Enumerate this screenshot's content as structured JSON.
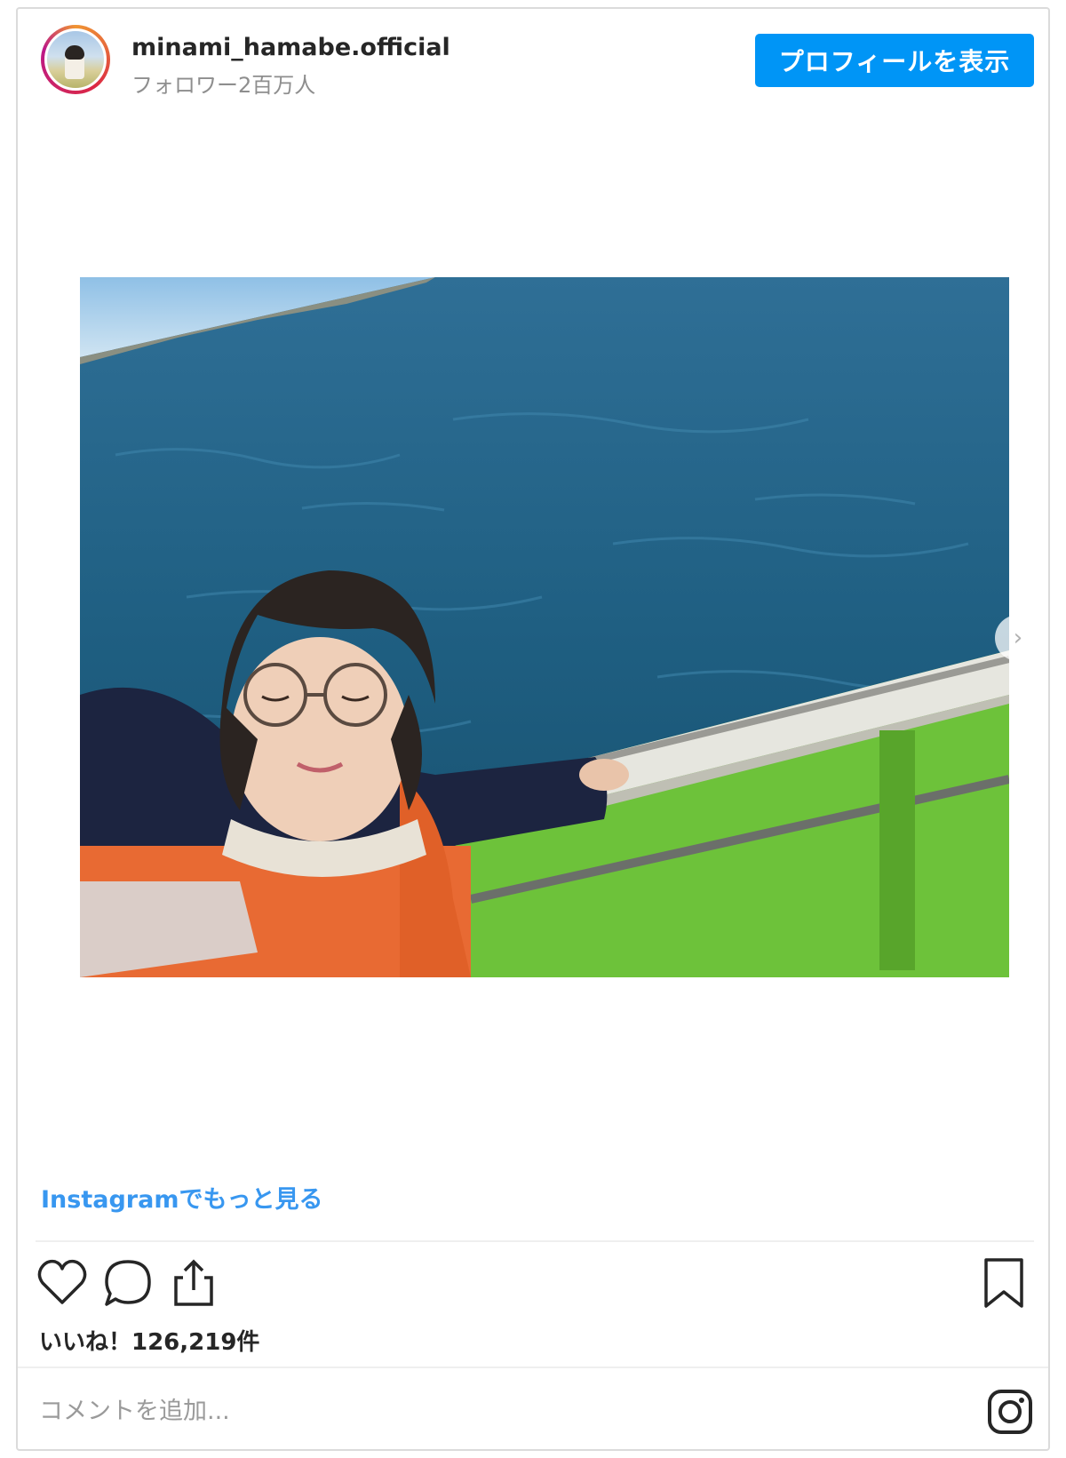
{
  "header": {
    "username": "minami_hamabe.official",
    "followers": "フォロワー2百万人",
    "profile_button": "プロフィールを表示"
  },
  "post": {
    "photo_icon": "photo-of-person-on-boat",
    "next_icon": "chevron-right-icon",
    "more_link": "Instagramでもっと見る",
    "likes": "いいね！126,219件"
  },
  "actions": {
    "icons": [
      "heart-icon",
      "comment-icon",
      "share-icon",
      "bookmark-icon"
    ]
  },
  "comment": {
    "placeholder": "コメントを追加..."
  },
  "colors": {
    "accent": "#0095f6",
    "link": "#3897f0"
  }
}
